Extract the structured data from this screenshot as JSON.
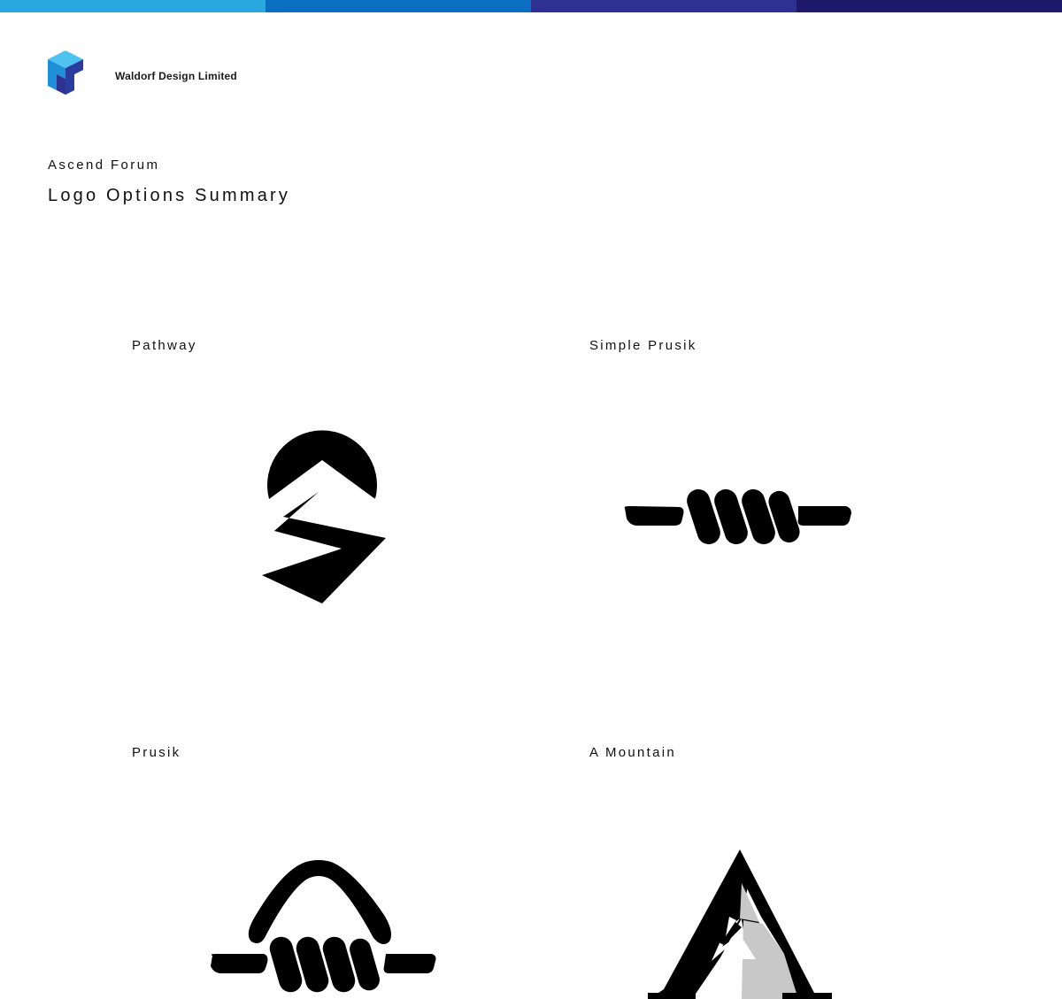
{
  "colors": {
    "top_bar": [
      "#29a8e0",
      "#0a6fc0",
      "#2f3192",
      "#1d1a6b"
    ],
    "brand_blue_light": "#29a8e0",
    "brand_blue_dark": "#2f3192",
    "logo_ink": "#000000",
    "mountain_shade": "#c8c8c8"
  },
  "header": {
    "company_name": "Waldorf Design Limited",
    "logo_icon": "waldorf-cube-logo-icon"
  },
  "document": {
    "project_name": "Ascend Forum",
    "title": "Logo Options Summary"
  },
  "options": [
    {
      "label": "Pathway",
      "icon": "pathway-logo"
    },
    {
      "label": "Simple Prusik",
      "icon": "simple-prusik-logo"
    },
    {
      "label": "Prusik",
      "icon": "prusik-logo"
    },
    {
      "label": "A Mountain",
      "icon": "a-mountain-logo"
    }
  ]
}
